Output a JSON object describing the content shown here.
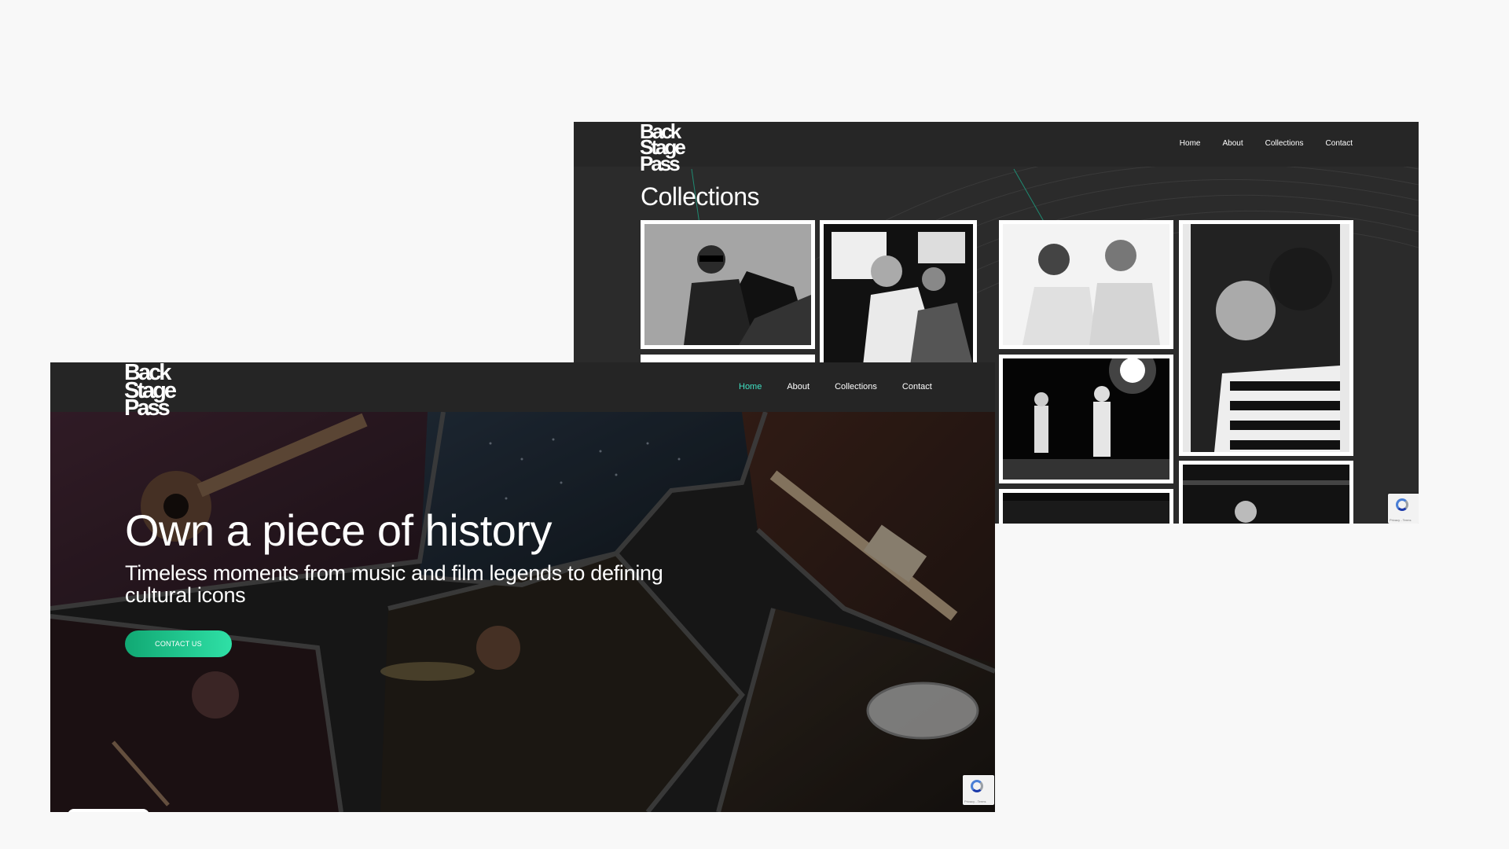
{
  "collections_page": {
    "logo": [
      "Back",
      "Stage",
      "Pass"
    ],
    "nav": [
      "Home",
      "About",
      "Collections",
      "Contact"
    ],
    "title": "Collections",
    "recaptcha_text": "Privacy - Terms"
  },
  "home_page": {
    "logo": [
      "Back",
      "Stage",
      "Pass"
    ],
    "nav": [
      "Home",
      "About",
      "Collections",
      "Contact"
    ],
    "active_nav": "Home",
    "hero_title": "Own a piece of history",
    "hero_subtitle": "Timeless moments from music and film legends to defining cultural icons",
    "cta_label": "CONTACT US",
    "recaptcha_text": "Privacy - Terms"
  },
  "colors": {
    "accent": "#3fe0c2",
    "cta_start": "#11a873",
    "cta_end": "#2fe0a6",
    "nav_bg": "#252525",
    "page_bg": "#f8f8f8"
  }
}
